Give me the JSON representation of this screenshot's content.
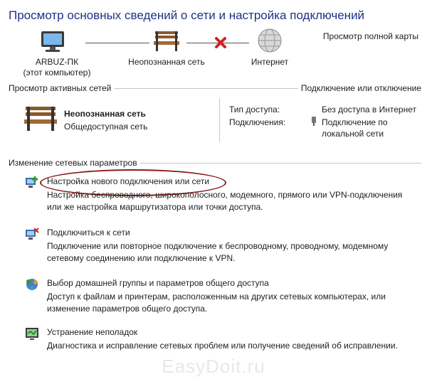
{
  "header": {
    "title": "Просмотр основных сведений о сети и настройка подключений",
    "full_map_link": "Просмотр полной карты"
  },
  "network_map": {
    "computer_name": "ARBUZ-ПК",
    "computer_sub": "(этот компьютер)",
    "network_name": "Неопознанная сеть",
    "internet_label": "Интернет"
  },
  "active_networks": {
    "section_title": "Просмотр активных сетей",
    "connect_disconnect_link": "Подключение или отключение",
    "network_name": "Неопознанная сеть",
    "network_type": "Общедоступная сеть",
    "access_type_label": "Тип доступа:",
    "access_type_value": "Без доступа в Интернет",
    "connections_label": "Подключения:",
    "connections_value_line1": "Подключение по",
    "connections_value_line2": "локальной сети"
  },
  "settings": {
    "section_title": "Изменение сетевых параметров",
    "items": [
      {
        "title": "Настройка нового подключения или сети",
        "desc1": "Настройка беспроводного, широкополосного, модемного, прямого или VPN-подключения",
        "desc2": "или же настройка маршрутизатора или точки доступа."
      },
      {
        "title": "Подключиться к сети",
        "desc1": "Подключение или повторное подключение к беспроводному, проводному, модемному",
        "desc2": "сетевому соединению или подключение к VPN."
      },
      {
        "title": "Выбор домашней группы и параметров общего доступа",
        "desc1": "Доступ к файлам и принтерам, расположенным на других сетевых компьютерах, или",
        "desc2": "изменение параметров общего доступа."
      },
      {
        "title": "Устранение неполадок",
        "desc1": "Диагностика и исправление сетевых проблем или получение сведений об исправлении."
      }
    ]
  },
  "watermark": "EasyDoit.ru",
  "colors": {
    "title": "#1e3287",
    "error_x": "#d42020",
    "annotation": "#8b1a1a"
  }
}
